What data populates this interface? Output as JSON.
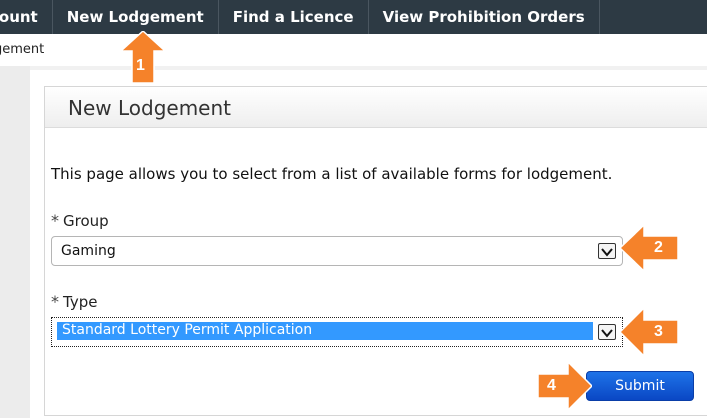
{
  "nav": {
    "items": [
      "count",
      "New Lodgement",
      "Find a Licence",
      "View Prohibition Orders"
    ]
  },
  "breadcrumb": "gement",
  "page": {
    "title": "New Lodgement",
    "intro": "This page allows you to select from a list of available forms for lodgement.",
    "required_marker": "*",
    "group_label": "Group",
    "group_value": "Gaming",
    "type_label": "Type",
    "type_value": "Standard Lottery Permit Application",
    "submit_label": "Submit"
  },
  "callouts": [
    "1",
    "2",
    "3",
    "4"
  ],
  "colors": {
    "callout": "#f5822a",
    "navbar": "#2d3a44",
    "highlight": "#3399ff",
    "button": "#0a47c4"
  }
}
